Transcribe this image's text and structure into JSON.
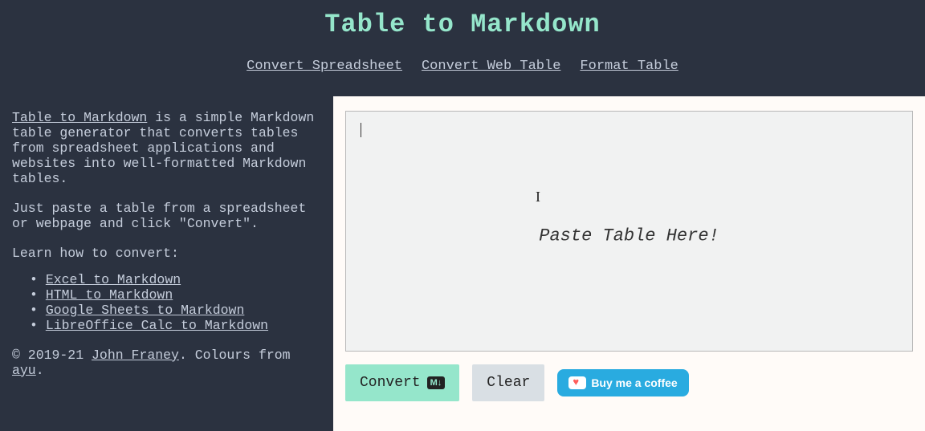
{
  "header": {
    "title": "Table to Markdown",
    "nav": {
      "convert_spreadsheet": "Convert Spreadsheet",
      "convert_web_table": "Convert Web Table",
      "format_table": "Format Table"
    }
  },
  "sidebar": {
    "intro_link": "Table to Markdown",
    "intro_rest": " is a simple Markdown table generator that converts tables from spreadsheet applications and websites into well-formatted Markdown tables.",
    "instructions": "Just paste a table from a spreadsheet or webpage and click \"Convert\".",
    "learn_label": "Learn how to convert:",
    "links": {
      "excel": "Excel to Markdown",
      "html": "HTML to Markdown",
      "gsheets": "Google Sheets to Markdown",
      "libre": "LibreOffice Calc to Markdown"
    },
    "footer": {
      "copyright": "© 2019-21 ",
      "author": "John Franey",
      "colours_prefix": ". Colours from ",
      "colours_link": "ayu",
      "period": "."
    }
  },
  "main": {
    "placeholder": "Paste Table Here!",
    "buttons": {
      "convert": "Convert",
      "convert_badge": "M↓",
      "clear": "Clear",
      "kofi": "Buy me a coffee"
    }
  }
}
